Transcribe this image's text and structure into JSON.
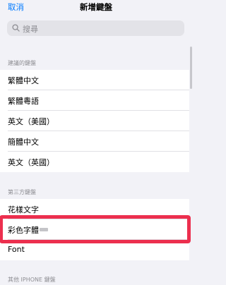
{
  "nav": {
    "cancel_label": "取消",
    "title": "新增鍵盤"
  },
  "search": {
    "placeholder": "搜尋",
    "icon": "search-icon"
  },
  "suggested": {
    "header": "建議的鍵盤",
    "items": [
      {
        "label": "繁體中文"
      },
      {
        "label": "繁體粵語"
      },
      {
        "label": "英文（美國）"
      },
      {
        "label": "簡體中文"
      },
      {
        "label": "英文（英國）"
      }
    ]
  },
  "third_party": {
    "header": "第三方鍵盤",
    "items": [
      {
        "label": "花樣文字"
      },
      {
        "label": "彩色字體"
      },
      {
        "label": "Font"
      }
    ]
  },
  "other": {
    "header": "其他 IPHONE 鍵盤"
  },
  "colors": {
    "accent": "#007aff",
    "highlight": "#ec2f4e",
    "background": "#f2f2f7",
    "row_background": "#ffffff",
    "secondary_text": "#8e8e93"
  }
}
